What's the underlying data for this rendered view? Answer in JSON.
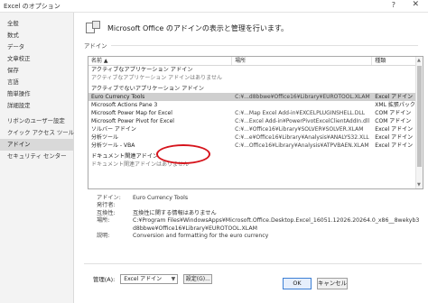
{
  "window": {
    "title": "Excel のオプション",
    "help": "?",
    "close": "✕"
  },
  "sidebar": {
    "items": [
      {
        "label": "全般"
      },
      {
        "label": "数式"
      },
      {
        "label": "データ"
      },
      {
        "label": "文章校正"
      },
      {
        "label": "保存"
      },
      {
        "label": "言語"
      },
      {
        "label": "簡単操作"
      },
      {
        "label": "詳細設定"
      },
      {
        "label": "リボンのユーザー設定"
      },
      {
        "label": "クイック アクセス ツール バー"
      },
      {
        "label": "アドイン",
        "active": true
      },
      {
        "label": "セキュリティ センター"
      }
    ]
  },
  "header": {
    "text": "Microsoft Office のアドインの表示と管理を行います。"
  },
  "section": {
    "label": "アドイン"
  },
  "table": {
    "columns": [
      "名前 ▲",
      "場所",
      "種類"
    ],
    "groups": [
      {
        "title": "アクティブなアプリケーション アドイン",
        "message": "アクティブなアプリケーション アドインはありません",
        "rows": []
      },
      {
        "title": "アクティブでないアプリケーション アドイン",
        "rows": [
          {
            "name": "Euro Currency Tools",
            "location": "C:¥...d8bbwe¥Office16¥Library¥EUROTOOL.XLAM",
            "type": "Excel アドイン",
            "selected": true
          },
          {
            "name": "Microsoft Actions Pane 3",
            "location": "",
            "type": "XML 拡張パック"
          },
          {
            "name": "Microsoft Power Map for Excel",
            "location": "C:¥...Map Excel Add-in¥EXCELPLUGINSHELL.DLL",
            "type": "COM アドイン"
          },
          {
            "name": "Microsoft Power Pivot for Excel",
            "location": "C:¥...Excel Add-in¥PowerPivotExcelClientAddIn.dll",
            "type": "COM アドイン"
          },
          {
            "name": "ソルバー アドイン",
            "location": "C:¥...¥Office16¥Library¥SOLVER¥SOLVER.XLAM",
            "type": "Excel アドイン"
          },
          {
            "name": "分析ツール",
            "location": "C:¥...e¥Office16¥Library¥Analysis¥ANALYS32.XLL",
            "type": "Excel アドイン"
          },
          {
            "name": "分析ツール - VBA",
            "location": "C:¥...Office16¥Library¥Analysis¥ATPVBAEN.XLAM",
            "type": "Excel アドイン"
          }
        ]
      },
      {
        "title": "ドキュメント関連アドイン",
        "message": "ドキュメント関連アドインはありません",
        "rows": []
      }
    ]
  },
  "details": {
    "addin_label": "アドイン:",
    "addin_value": "Euro Currency Tools",
    "publisher_label": "発行者:",
    "publisher_value": "",
    "compat_label": "互換性:",
    "compat_value": "互換性に関する情報はありません",
    "location_label": "場所:",
    "location_value": "C:¥Program Files¥WindowsApps¥Microsoft.Office.Desktop.Excel_16051.12026.20264.0_x86__8wekyb3d8bbwe¥Office16¥Library¥EUROTOOL.XLAM",
    "desc_label": "説明:",
    "desc_value": "Conversion and formatting for the euro currency"
  },
  "manage": {
    "label": "管理(A):",
    "selected": "Excel アドイン",
    "go": "設定(G)..."
  },
  "buttons": {
    "ok": "OK",
    "cancel": "キャンセル"
  },
  "colors": {
    "highlight_oval": "#d6141c",
    "selected_row": "#cfcfcf",
    "active_sidebar": "#d9d9d9"
  }
}
